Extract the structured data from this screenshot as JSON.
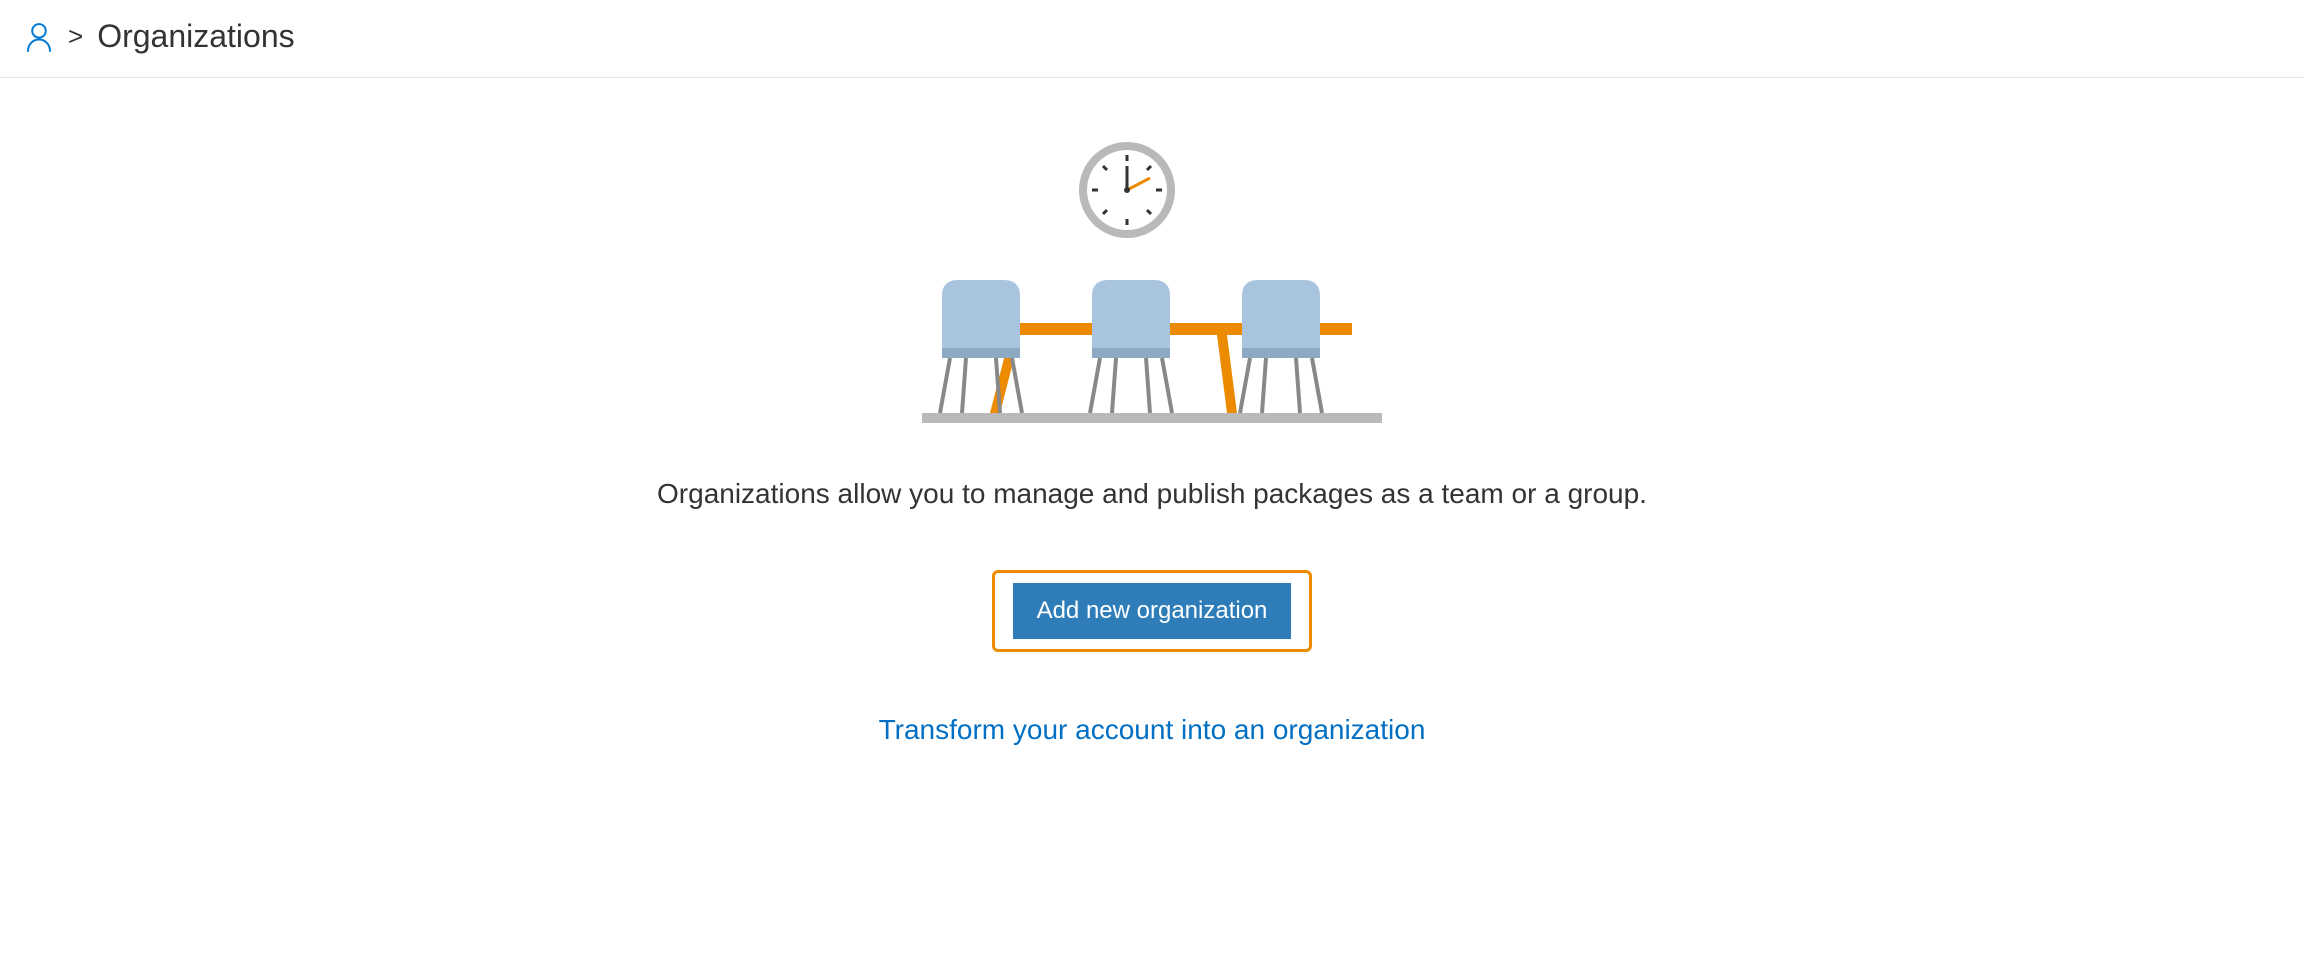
{
  "breadcrumb": {
    "separator": ">",
    "title": "Organizations"
  },
  "main": {
    "description": "Organizations allow you to manage and publish packages as a team or a group.",
    "add_button_label": "Add new organization",
    "transform_link_label": "Transform your account into an organization"
  },
  "colors": {
    "accent_blue": "#2e7cb8",
    "highlight_orange": "#ed8b00",
    "link_blue": "#006fc4"
  }
}
